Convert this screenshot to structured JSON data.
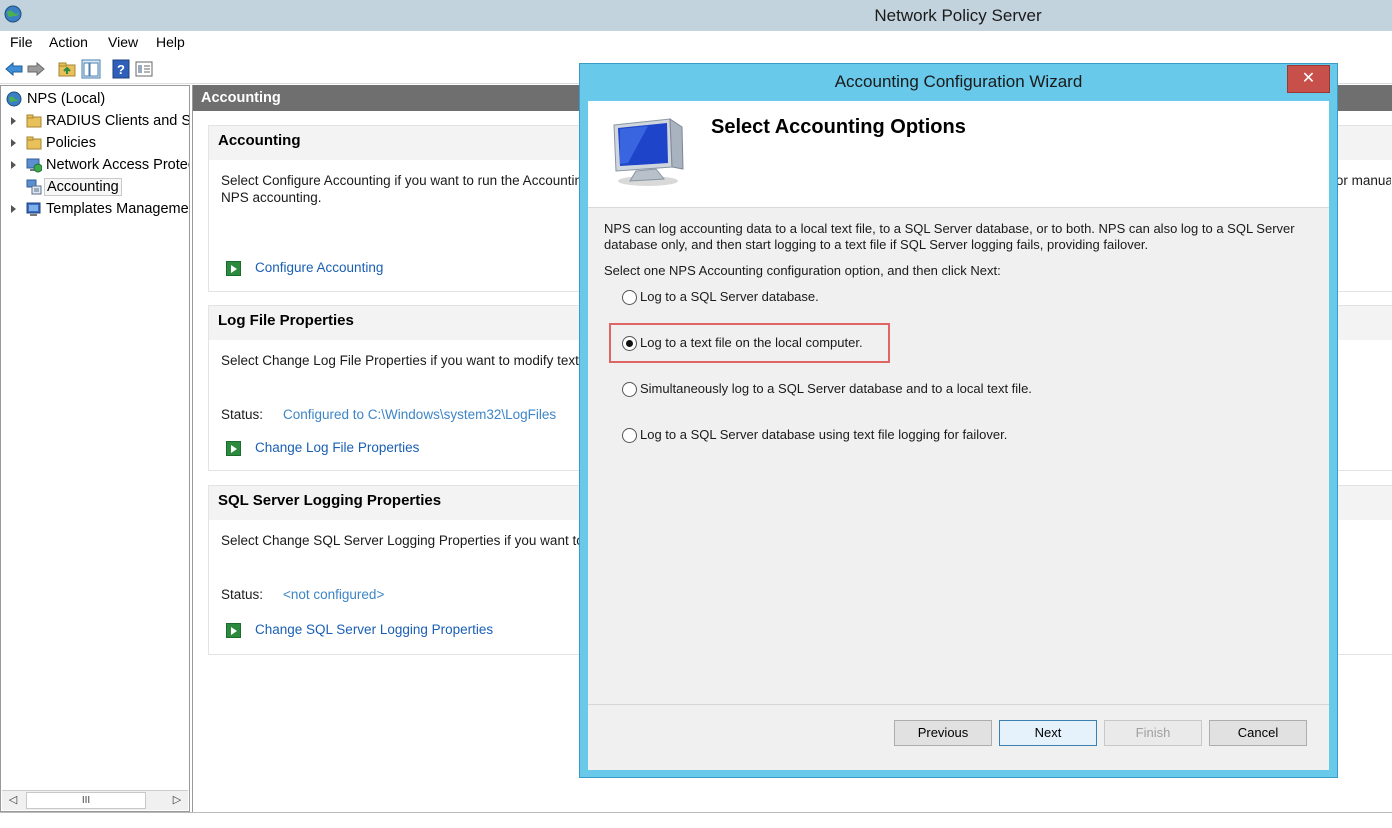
{
  "window": {
    "title": "Network Policy Server"
  },
  "menu": [
    "File",
    "Action",
    "View",
    "Help"
  ],
  "tree": {
    "items": [
      {
        "label": "NPS (Local)",
        "icon": "globe-icon"
      },
      {
        "label": "RADIUS Clients and Servers",
        "icon": "folder-icon"
      },
      {
        "label": "Policies",
        "icon": "folder-icon"
      },
      {
        "label": "Network Access Protection",
        "icon": "nap-icon"
      },
      {
        "label": "Accounting",
        "icon": "accounting-icon"
      },
      {
        "label": "Templates Management",
        "icon": "templates-icon"
      }
    ],
    "scroll_thumb": "III"
  },
  "content": {
    "header": "Accounting",
    "sections": [
      {
        "title": "Accounting",
        "description": "Select Configure Accounting if you want to run the Accounting Configuration Wizard, which allows you to configure or reconfigure NPS accounting. To configure accounting, run the wizard or manually configure accounting properties. Run the Accounting Configuration Wizard can",
        "description2": "NPS accounting.",
        "link": "Configure Accounting"
      },
      {
        "title": "Log File Properties",
        "description": "Select Change Log File Properties if you want to modify text log file properties.",
        "status_label": "Status:",
        "status_value": "Configured to C:\\Windows\\system32\\LogFiles",
        "link": "Change Log File Properties"
      },
      {
        "title": "SQL Server Logging Properties",
        "description": "Select Change SQL Server Logging Properties if you want to modify SQL Server logging properties.",
        "status_label": "Status:",
        "status_value": "<not configured>",
        "link": "Change SQL Server Logging Properties"
      }
    ]
  },
  "wizard": {
    "title": "Accounting Configuration Wizard",
    "close": "✕",
    "heading": "Select Accounting Options",
    "description": "NPS can log accounting data to a local text file, to a SQL Server database, or to both. NPS can also log to a SQL Server database only, and then start logging to a text file if SQL Server logging fails, providing failover.",
    "instruction": "Select one NPS Accounting configuration option, and then click Next:",
    "options": [
      {
        "label": "Log to a SQL Server database.",
        "selected": false
      },
      {
        "label": "Log to a text file on the local computer.",
        "selected": true
      },
      {
        "label": "Simultaneously log to a SQL Server database and to a local text file.",
        "selected": false
      },
      {
        "label": "Log to a SQL Server database using text file logging for failover.",
        "selected": false
      }
    ],
    "buttons": {
      "previous": "Previous",
      "next": "Next",
      "finish": "Finish",
      "cancel": "Cancel"
    }
  },
  "colors": {
    "titlebar": "#c3d3de",
    "wizard_frame": "#68c9ea",
    "close": "#c7504a",
    "link": "#1a5fb4",
    "highlight": "#e06666"
  }
}
